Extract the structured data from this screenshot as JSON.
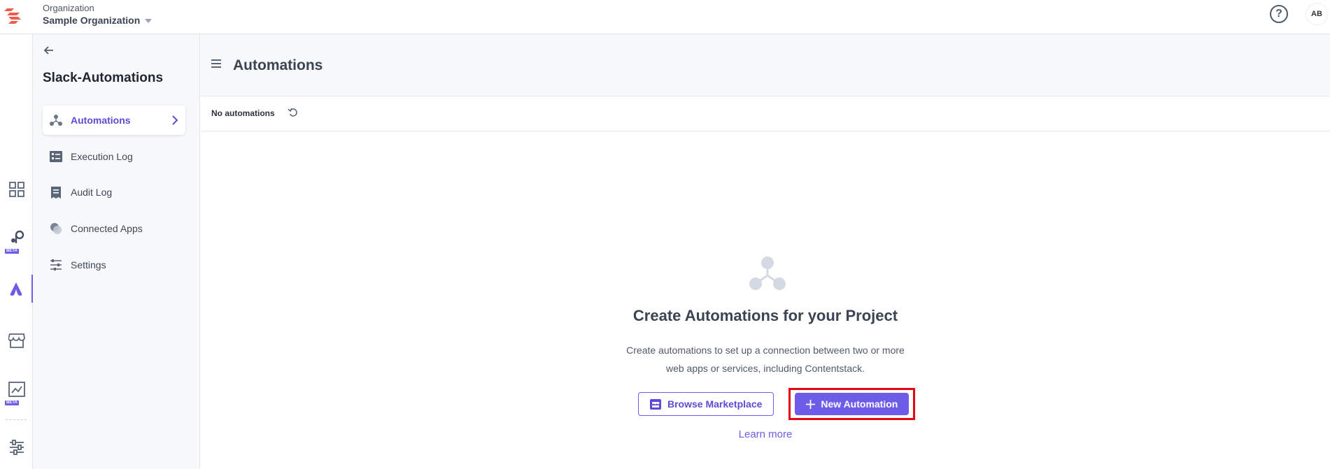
{
  "header": {
    "org_label": "Organization",
    "org_name": "Sample Organization",
    "help_icon": "help-circle-icon",
    "avatar_initials": "AB"
  },
  "rail": {
    "items": [
      {
        "icon": "dashboard-grid-icon"
      },
      {
        "icon": "beta-personalize-icon",
        "badge": "BETA"
      },
      {
        "icon": "automations-icon"
      },
      {
        "icon": "marketplace-store-icon"
      },
      {
        "icon": "beta-launch-icon",
        "badge": "BETA"
      },
      {
        "icon": "settings-sliders-icon"
      }
    ]
  },
  "sidebar": {
    "project_title": "Slack-Automations",
    "items": [
      {
        "label": "Automations",
        "icon": "automations-icon",
        "active": true
      },
      {
        "label": "Execution Log",
        "icon": "list-icon"
      },
      {
        "label": "Audit Log",
        "icon": "document-icon"
      },
      {
        "label": "Connected Apps",
        "icon": "connected-apps-icon"
      },
      {
        "label": "Settings",
        "icon": "sliders-icon"
      }
    ]
  },
  "main": {
    "title": "Automations",
    "count_label": "No automations",
    "empty_state": {
      "title": "Create Automations for your Project",
      "desc_line1": "Create automations to set up a connection between two or more",
      "desc_line2": "web apps or services, including Contentstack.",
      "browse_label": "Browse Marketplace",
      "new_label": "New Automation",
      "learn_more": "Learn more"
    }
  },
  "colors": {
    "accent": "#6c5ce7",
    "highlight": "#e30613",
    "text_dark": "#3a4452"
  }
}
